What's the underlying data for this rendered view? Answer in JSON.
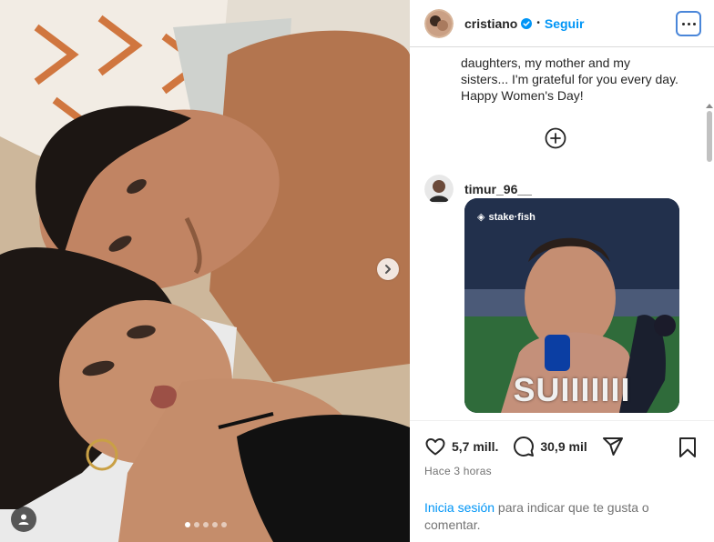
{
  "author": {
    "username": "cristiano",
    "separator": "•",
    "follow_label": "Seguir",
    "verified": true
  },
  "caption": {
    "text": "daughters, my mother and my sisters... I'm grateful for you every day. Happy Women's Day!"
  },
  "comments": [
    {
      "username": "timur_96__",
      "gif": {
        "watermark": "stake·fish",
        "caption": "SUIIIIIII"
      }
    }
  ],
  "stats": {
    "likes": "5,7 mill.",
    "comments": "30,9 mil"
  },
  "timestamp": "Hace 3 horas",
  "login_prompt": {
    "link": "Inicia sesión",
    "text": " para indicar que te gusta o comentar."
  },
  "carousel": {
    "total_slides": 5,
    "active_index": 0
  },
  "colors": {
    "accent": "#0095f6",
    "verified": "#0095f6",
    "text": "#262626",
    "muted": "#737373"
  },
  "icons": {
    "like": "heart-icon",
    "comment": "speech-bubble-icon",
    "share": "paper-plane-icon",
    "save": "bookmark-icon",
    "more": "more-options-icon",
    "next": "chevron-right-icon",
    "add": "plus-circle-icon",
    "tag": "user-tag-icon"
  }
}
